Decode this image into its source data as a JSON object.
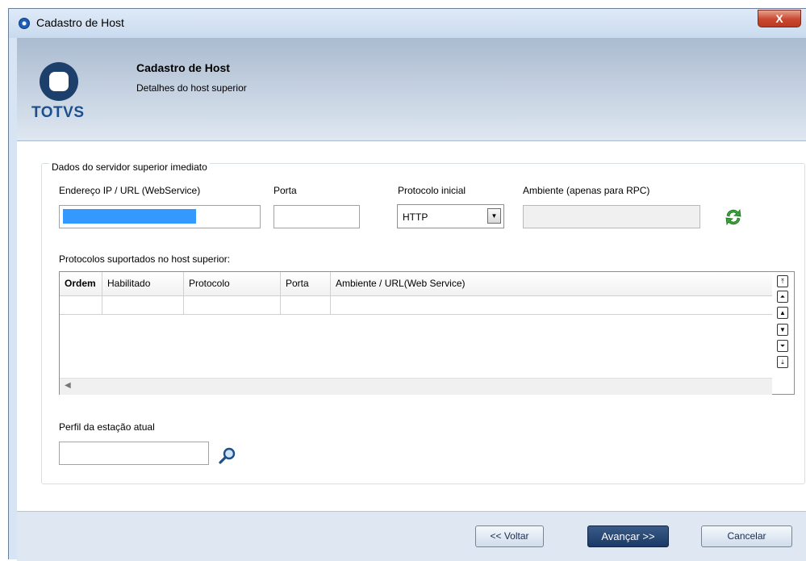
{
  "window": {
    "title": "Cadastro de Host",
    "close_label": "X"
  },
  "header": {
    "logo_text": "TOTVS",
    "title": "Cadastro de Host",
    "subtitle": "Detalhes do host superior"
  },
  "group": {
    "label": "Dados do servidor superior imediato"
  },
  "fields": {
    "address_label": "Endereço IP / URL (WebService)",
    "address_value": "",
    "port_label": "Porta",
    "port_value": "",
    "protocol_label": "Protocolo inicial",
    "protocol_value": "HTTP",
    "environment_label": "Ambiente (apenas para RPC)",
    "environment_value": ""
  },
  "protocols": {
    "label": "Protocolos suportados no host superior:",
    "columns": [
      "Ordem",
      "Habilitado",
      "Protocolo",
      "Porta",
      "Ambiente / URL(Web Service)"
    ]
  },
  "profile": {
    "label": "Perfil da estação atual",
    "value": ""
  },
  "footer": {
    "back_label": "<< Voltar",
    "next_label": "Avançar >>",
    "cancel_label": "Cancelar"
  },
  "colors": {
    "accent": "#1b3966",
    "selection": "#3399ff",
    "refresh_green": "#3aa33a"
  }
}
